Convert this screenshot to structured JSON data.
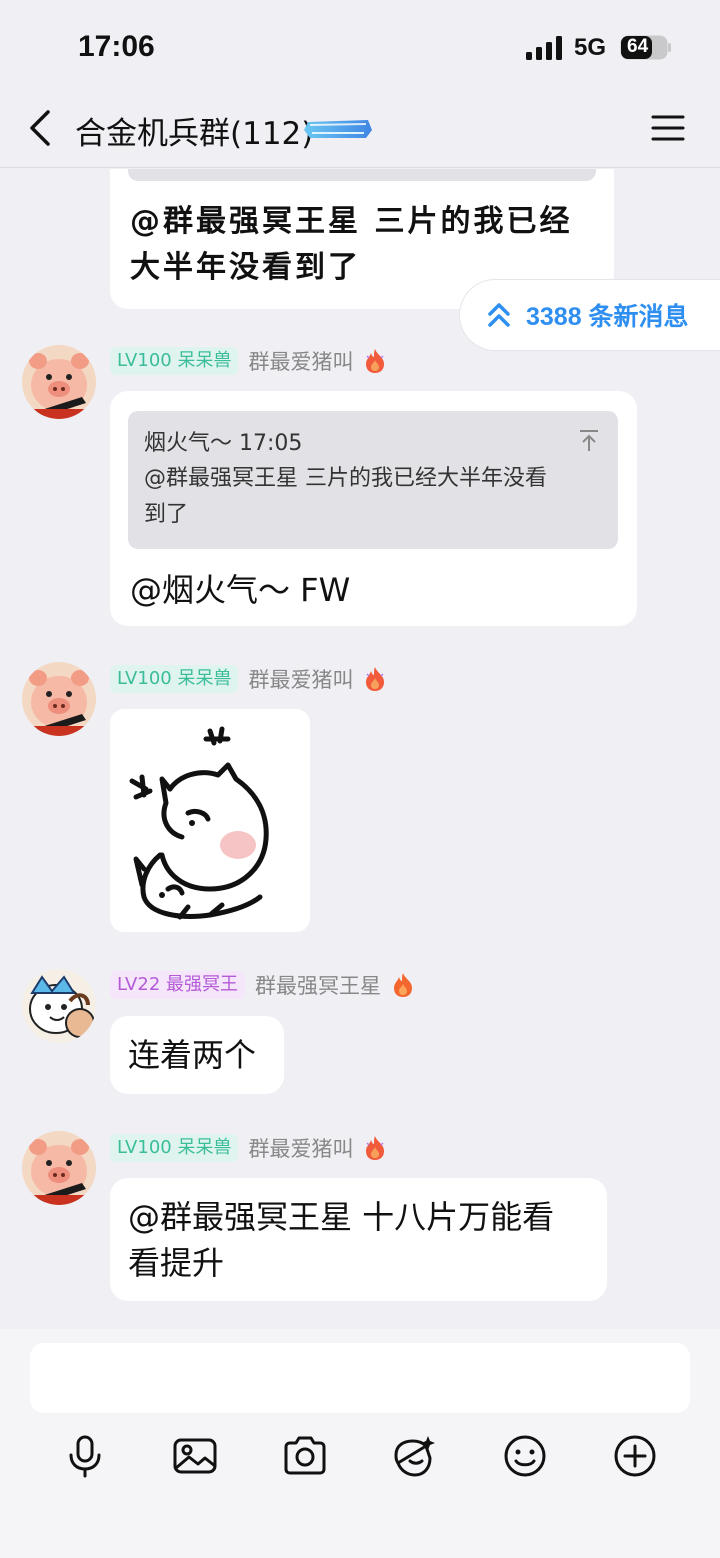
{
  "status_bar": {
    "time": "17:06",
    "network": "5G",
    "battery": "64"
  },
  "header": {
    "title": "合金机兵群(112)"
  },
  "messages": [
    {
      "text_line1": "@群最强冥王星 三片的我已经",
      "text_line2": "大半年没看到了"
    },
    {
      "level": "LV100 呆呆兽",
      "sender": "群最爱猪叫",
      "reply_header": "烟火气～ 17:05",
      "reply_line1": "@群最强冥王星 三片的我已经大半年没看",
      "reply_line2": "到了",
      "text": "@烟火气～ FW"
    },
    {
      "level": "LV100 呆呆兽",
      "sender": "群最爱猪叫"
    },
    {
      "level": "LV22 最强冥王",
      "sender": "群最强冥王星",
      "text": "连着两个"
    },
    {
      "level": "LV100 呆呆兽",
      "sender": "群最爱猪叫",
      "text_line1": "@群最强冥王星 十八片万能看",
      "text_line2": "看提升"
    }
  ],
  "new_messages": {
    "label": "3388 条新消息"
  },
  "input": {
    "value": ""
  },
  "toolbar": [
    "mic-icon",
    "image-icon",
    "camera-icon",
    "sticker-icon",
    "emoji-icon",
    "plus-icon"
  ],
  "colors": {
    "accent": "#2f8ff0",
    "level_green": "#3bbd9a",
    "level_purple": "#b45ad6",
    "background": "#f0eff4"
  }
}
